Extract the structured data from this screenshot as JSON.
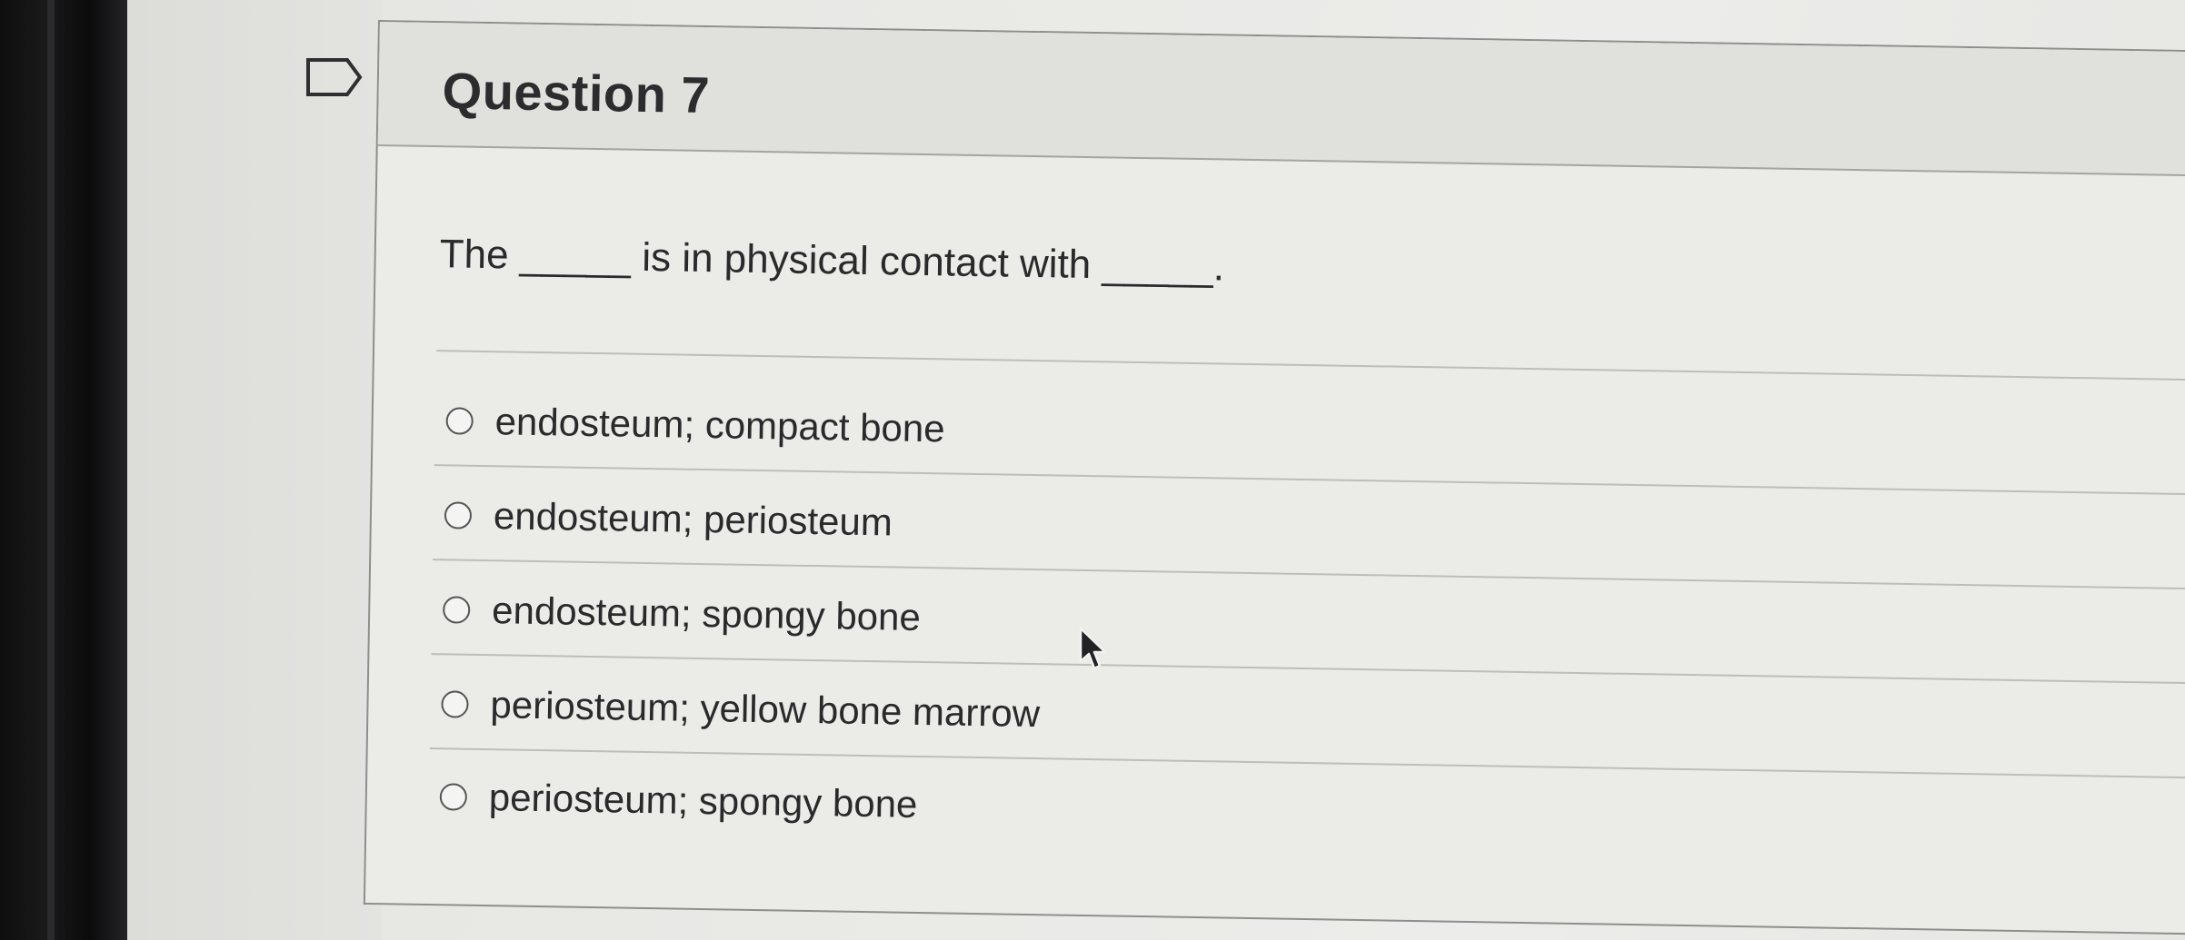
{
  "question": {
    "title": "Question 7",
    "text": "The _____ is in physical contact with _____.",
    "options": [
      {
        "label": "endosteum; compact bone",
        "selected": false
      },
      {
        "label": "endosteum; periosteum",
        "selected": false
      },
      {
        "label": "endosteum; spongy bone",
        "selected": false
      },
      {
        "label": "periosteum; yellow bone marrow",
        "selected": false
      },
      {
        "label": "periosteum; spongy bone",
        "selected": false
      }
    ]
  },
  "icons": {
    "flag": "flag-icon",
    "cursor": "mouse-pointer-icon"
  },
  "colors": {
    "text": "#2a2a2c",
    "border": "#8e8e8c",
    "header_bg": "#e0e0dd"
  }
}
